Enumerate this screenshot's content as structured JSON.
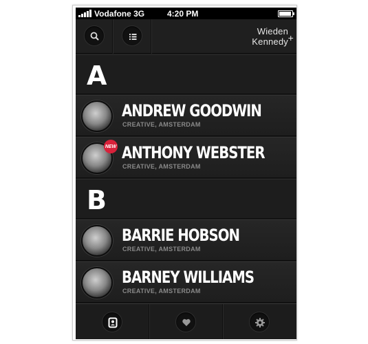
{
  "status_bar": {
    "carrier": "Vodafone 3G",
    "time": "4:20 PM"
  },
  "header": {
    "brand_line1": "Wieden",
    "brand_line2": "Kennedy",
    "brand_plus": "+",
    "icons": [
      "search-icon",
      "list-icon"
    ]
  },
  "sections": [
    {
      "letter": "A",
      "contacts": [
        {
          "name": "ANDREW GOODWIN",
          "role": "CREATIVE, AMSTERDAM",
          "badge": ""
        },
        {
          "name": "ANTHONY WEBSTER",
          "role": "CREATIVE, AMSTERDAM",
          "badge": "NEW"
        }
      ]
    },
    {
      "letter": "B",
      "contacts": [
        {
          "name": "BARRIE HOBSON",
          "role": "CREATIVE, AMSTERDAM",
          "badge": ""
        },
        {
          "name": "BARNEY WILLIAMS",
          "role": "CREATIVE, AMSTERDAM",
          "badge": ""
        }
      ]
    }
  ],
  "tab_bar": {
    "tabs": [
      "contacts-icon",
      "heart-icon",
      "gear-icon"
    ]
  },
  "colors": {
    "background": "#1b1b1b",
    "text": "#ffffff",
    "subtext": "#8a8a8a",
    "badge": "#d8213a"
  }
}
